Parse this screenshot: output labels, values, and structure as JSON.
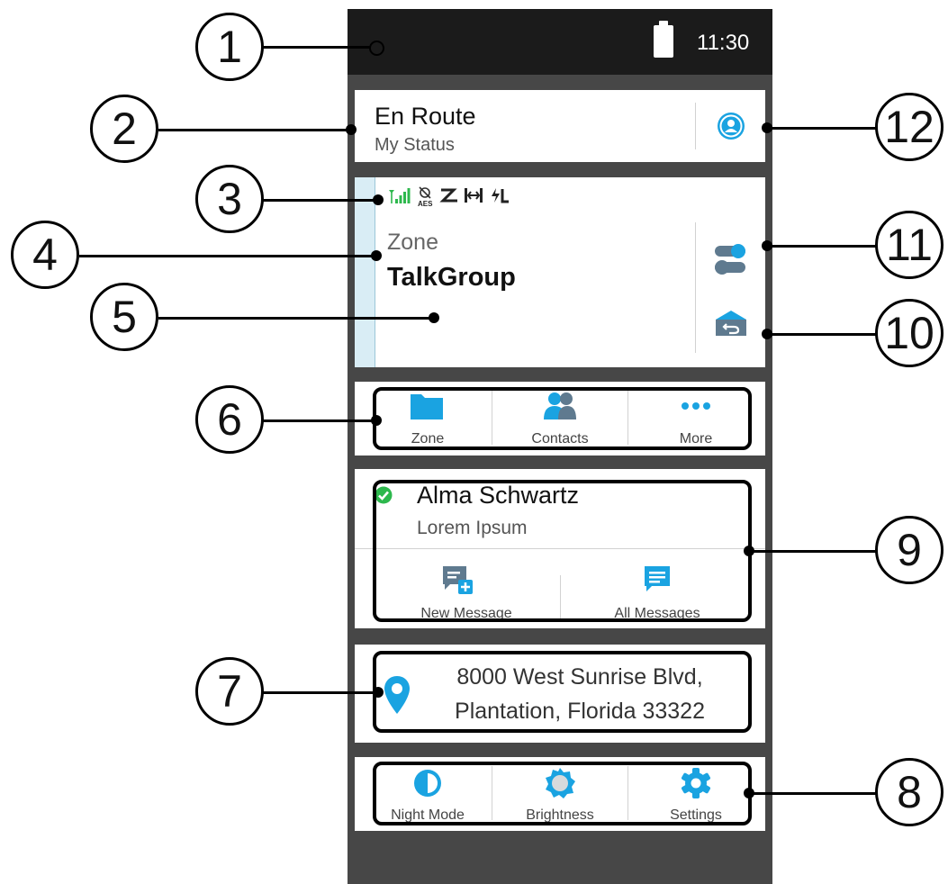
{
  "status_bar": {
    "time": "11:30",
    "battery_icon": "battery-icon"
  },
  "status_card": {
    "status": "En Route",
    "label": "My Status",
    "icon": "user-circle-icon"
  },
  "channel": {
    "indicators": [
      "signal-icon",
      "aes-icon",
      "scan-icon",
      "talkaround-icon",
      "low-power-icon"
    ],
    "aes_text": "AES",
    "zone": "Zone",
    "talkgroup": "TalkGroup",
    "right_icons": [
      "toggle-icon",
      "home-return-icon"
    ]
  },
  "nav_tabs": [
    {
      "label": "Zone",
      "icon": "folder-icon"
    },
    {
      "label": "Contacts",
      "icon": "contacts-icon"
    },
    {
      "label": "More",
      "icon": "more-icon"
    }
  ],
  "contact": {
    "name": "Alma Schwartz",
    "subtitle": "Lorem Ipsum",
    "actions": [
      {
        "label": "New Message",
        "icon": "new-message-icon"
      },
      {
        "label": "All Messages",
        "icon": "all-messages-icon"
      }
    ]
  },
  "location": {
    "line1": "8000 West Sunrise Blvd,",
    "line2": "Plantation, Florida 33322",
    "icon": "location-pin-icon"
  },
  "quick_settings": [
    {
      "label": "Night Mode",
      "icon": "night-mode-icon"
    },
    {
      "label": "Brightness",
      "icon": "brightness-icon"
    },
    {
      "label": "Settings",
      "icon": "settings-gear-icon"
    }
  ],
  "callouts": [
    "1",
    "2",
    "3",
    "4",
    "5",
    "6",
    "7",
    "8",
    "9",
    "10",
    "11",
    "12"
  ],
  "colors": {
    "accent": "#1aa3e1",
    "statusbar": "#1b1b1b",
    "frame": "#474747",
    "check": "#2db84d"
  }
}
